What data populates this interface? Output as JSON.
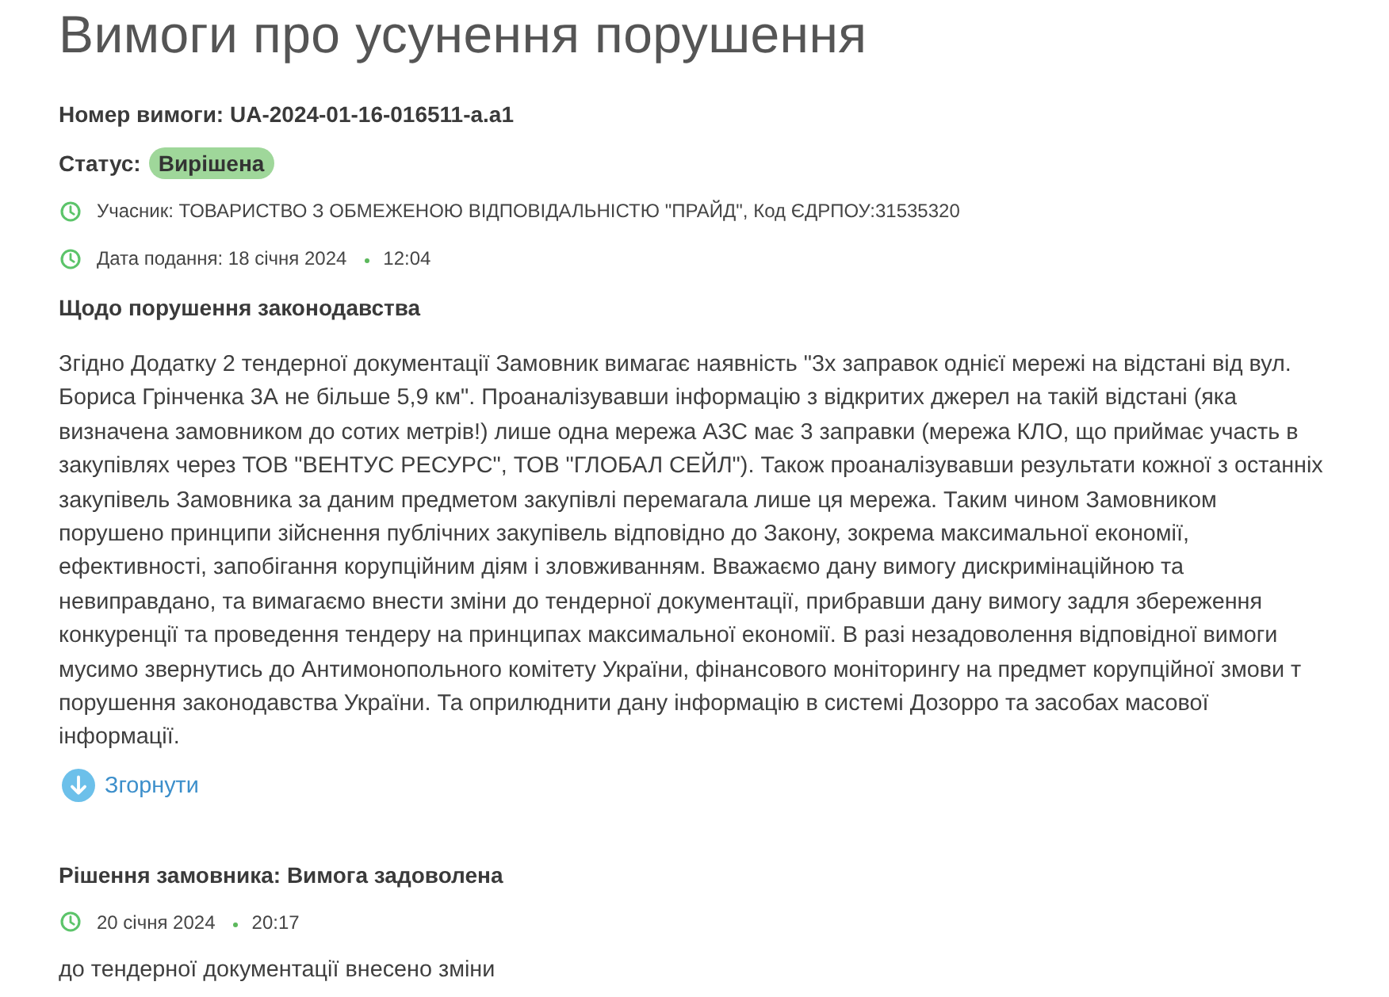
{
  "page": {
    "title": "Вимоги про усунення порушення"
  },
  "complaint": {
    "number": "Номер вимоги: UA-2024-01-16-016511-a.a1",
    "status_label": "Статус:",
    "status": "Вирішена",
    "participant": "Учасник: ТОВАРИСТВО З ОБМЕЖЕНОЮ ВІДПОВІДАЛЬНІСТЮ \"ПРАЙД\", Код ЄДРПОУ:31535320",
    "submitted_date": "Дата подання: 18 січня 2024",
    "submitted_time": "12:04",
    "subject": "Щодо порушення законодавства",
    "description": "Згідно Додатку 2 тендерної документації Замовник вимагає наявність \"3х заправок однієї мережі на відстані від вул. Бориса Грінченка 3А не більше 5,9 км\". Проаналізувавши інформацію з відкритих джерел на такій відстані (яка визначена замовником до сотих метрів!) лише одна мережа АЗС має 3 заправки (мережа КЛО, що приймає участь в закупівлях через ТОВ \"ВЕНТУС РЕСУРС\", ТОВ \"ГЛОБАЛ СЕЙЛ\"). Також проаналізувавши результати кожної з останніх закупівель Замовника за даним предметом закупівлі перемагала лише ця мережа. Таким чином Замовником порушено принципи зійснення публічних закупівель відповідно до Закону, зокрема максимальної економії, ефективності, запобігання корупційним діям і зловживанням. Вважаємо дану вимогу дискримінаційною та невиправдано, та вимагаємо внести зміни до тендерної документації, прибравши дану вимогу задля збереження конкуренції та проведення тендеру на принципах максимальної економії. В разі незадоволення відповідної вимоги мусимо звернутись до Антимонопольного комітету України, фінансового моніторингу на предмет корупційної змови т порушення законодавства України. Та оприлюднити дану інформацію в системі Дозорро та засобах масової інформації.",
    "collapse_link": "Згорнути"
  },
  "resolution": {
    "heading": "Рішення замовника: Вимога задоволена",
    "date": "20 січня 2024",
    "time": "20:17",
    "text": "до тендерної документації внесено зміни"
  }
}
